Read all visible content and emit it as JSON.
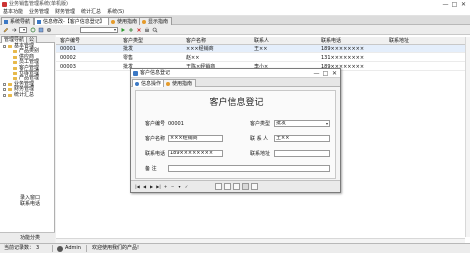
{
  "window": {
    "title": "业务销售管理系统(单机版)",
    "controls": [
      "—",
      "□",
      "✕"
    ]
  },
  "menu": [
    "基本功能",
    "业务管理",
    "财务管理",
    "统计汇总",
    "系统(S)"
  ],
  "page_tabs": [
    {
      "label": "系统导航"
    },
    {
      "label": "信息修改-【客户信息登记】"
    },
    {
      "label": "使用指南"
    },
    {
      "label": "显示指南"
    }
  ],
  "nav": {
    "tabs": [
      "管理导航",
      "公"
    ],
    "tree": [
      {
        "label": "基本管理",
        "level": 0,
        "expanded": true
      },
      {
        "label": "产品类别",
        "level": 1
      },
      {
        "label": "供应商",
        "level": 1
      },
      {
        "label": "员工管理",
        "level": 1
      },
      {
        "label": "客户管理",
        "level": 1
      },
      {
        "label": "仓库管理",
        "level": 1
      },
      {
        "label": "产品管理",
        "level": 1
      },
      {
        "label": "业务管理",
        "level": 0,
        "expanded": false
      },
      {
        "label": "财务管理",
        "level": 0,
        "expanded": false
      },
      {
        "label": "统计汇总",
        "level": 0,
        "expanded": false
      }
    ],
    "bottom_items": [
      "录入窗口",
      "联系电话"
    ],
    "footer": "功能分类"
  },
  "grid": {
    "columns": [
      "客户编号",
      "客户类型",
      "客户名称",
      "联系人",
      "联系电话",
      "联系地址"
    ],
    "rows": [
      {
        "id": "00001",
        "type": "批发",
        "name": "×××经销商",
        "contact": "王××",
        "phone": "189××××××××",
        "address": "",
        "selected": true
      },
      {
        "id": "00002",
        "type": "零售",
        "name": "赵××",
        "contact": "",
        "phone": "131××××××××",
        "address": ""
      },
      {
        "id": "00003",
        "type": "批发",
        "name": "王陈×经销商",
        "contact": "李小×",
        "phone": "189××××××××",
        "address": ""
      }
    ]
  },
  "dialog": {
    "title": "客户信息登记",
    "tabs": [
      "信息操作",
      "使用指南"
    ],
    "form_title": "客户信息登记",
    "fields": {
      "id_label": "客户编号",
      "id_value": "00001",
      "type_label": "客户类型",
      "type_value": "批发",
      "name_label": "客户名称",
      "name_value": "×××经销商",
      "contact_label": "联 系 人",
      "contact_value": "王××",
      "phone_label": "联系电话",
      "phone_value": "189××××××××",
      "address_label": "联系地址",
      "address_value": "",
      "note_label": "备    注",
      "note_value": ""
    }
  },
  "statusbar": {
    "label1": "当前记录数：",
    "count": "3",
    "user": "Admin",
    "message": "欢迎使用我们的产品!"
  },
  "colors": {
    "accent": "#3b78c4",
    "folder": "#e7b94a",
    "selected_row": "#e4eefb",
    "guide_icon": "#e59b2b"
  }
}
